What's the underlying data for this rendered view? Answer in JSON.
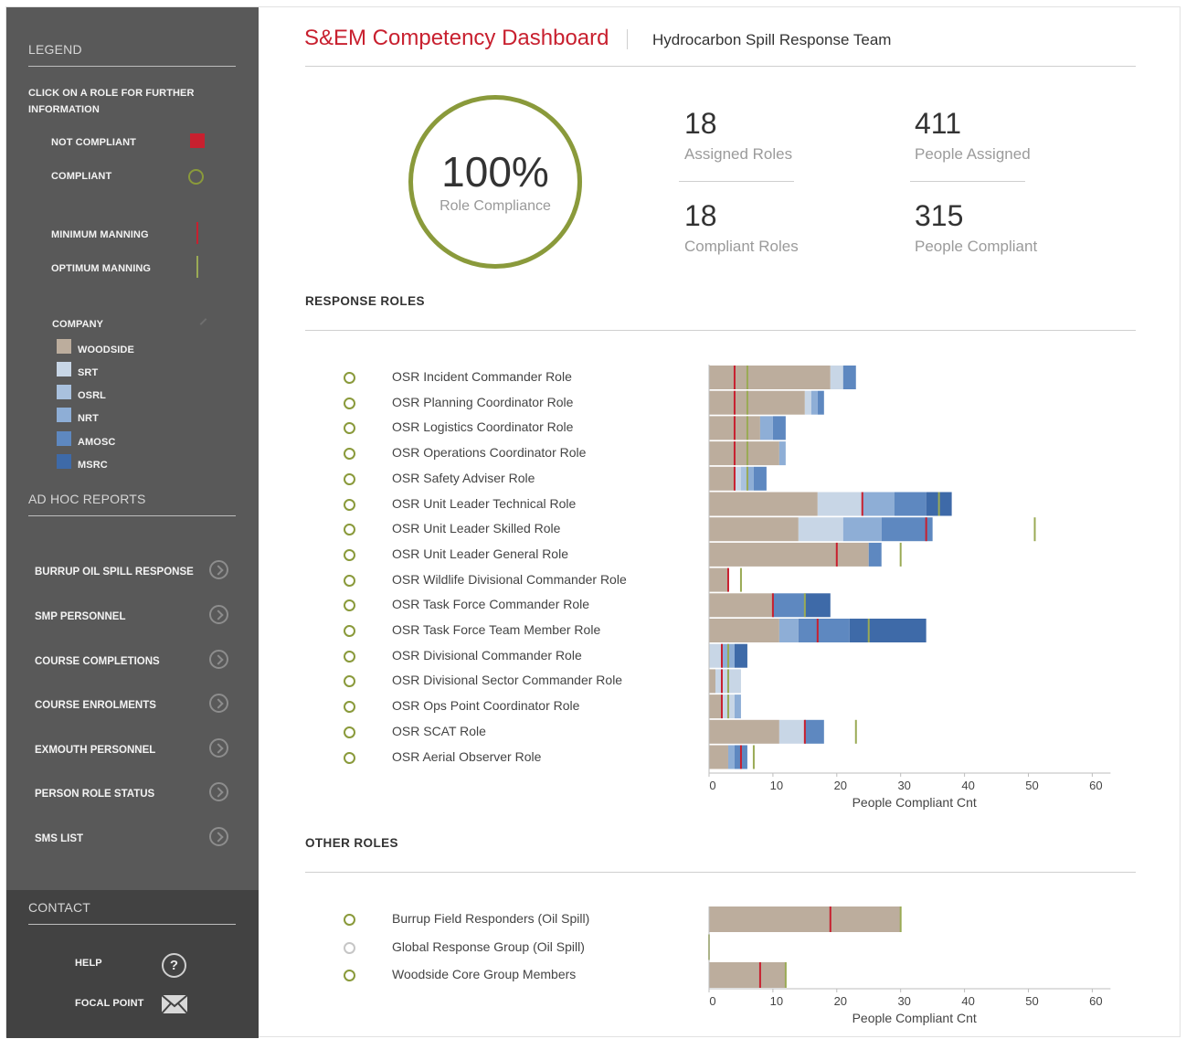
{
  "sidebar": {
    "legend_title": "LEGEND",
    "instructions": [
      "CLICK ON A ROLE FOR FURTHER",
      "INFORMATION"
    ],
    "status_items": [
      {
        "label": "NOT COMPLIANT",
        "icon": "red-square-icon",
        "color": "#c8202f"
      },
      {
        "label": "COMPLIANT",
        "icon": "green-ring-icon",
        "color": "#8a9a3b"
      }
    ],
    "manning_items": [
      {
        "label": "MINIMUM MANNING",
        "icon": "red-line-icon",
        "color": "#c8202f"
      },
      {
        "label": "OPTIMUM MANNING",
        "icon": "green-line-icon",
        "color": "#9aaa55"
      }
    ],
    "company_title": "COMPANY",
    "companies": [
      {
        "label": "WOODSIDE",
        "color": "#bcad9d"
      },
      {
        "label": "SRT",
        "color": "#c8d6e6"
      },
      {
        "label": "OSRL",
        "color": "#a9c1de"
      },
      {
        "label": "NRT",
        "color": "#8eaed6"
      },
      {
        "label": "AMOSC",
        "color": "#5e88c0"
      },
      {
        "label": "MSRC",
        "color": "#3e6aa8"
      }
    ],
    "adhoc_title": "AD HOC REPORTS",
    "reports": [
      "BURRUP OIL SPILL RESPONSE",
      "SMP PERSONNEL",
      "COURSE COMPLETIONS",
      "COURSE ENROLMENTS",
      "EXMOUTH PERSONNEL",
      "PERSON ROLE STATUS",
      "SMS LIST"
    ],
    "contact_title": "CONTACT",
    "contact_items": [
      {
        "label": "HELP",
        "icon": "help-circle-icon"
      },
      {
        "label": "FOCAL POINT",
        "icon": "envelope-icon"
      }
    ]
  },
  "header": {
    "title": "S&EM Competency Dashboard",
    "team": "Hydrocarbon Spill Response Team"
  },
  "summary": {
    "compliance_value": "100%",
    "compliance_label": "Role Compliance",
    "compliance_fraction": 1.0,
    "stats": [
      {
        "value": "18",
        "label": "Assigned Roles"
      },
      {
        "value": "411",
        "label": "People Assigned"
      },
      {
        "value": "18",
        "label": "Compliant Roles"
      },
      {
        "value": "315",
        "label": "People Compliant"
      }
    ]
  },
  "response_title": "RESPONSE ROLES",
  "other_title": "OTHER ROLES",
  "chart_data": [
    {
      "type": "bar",
      "orientation": "horizontal",
      "stacked": true,
      "xlabel": "People Compliant Cnt",
      "xlim": [
        0,
        60
      ],
      "xticks": [
        0,
        10,
        20,
        30,
        40,
        50,
        60
      ],
      "status_color_compliant": "#8a9a3b",
      "categories": [
        "OSR Incident Commander Role",
        "OSR Planning Coordinator Role",
        "OSR Logistics Coordinator Role",
        "OSR Operations Coordinator Role",
        "OSR Safety Adviser Role",
        "OSR Unit Leader Technical Role",
        "OSR Unit Leader Skilled Role",
        "OSR Unit Leader General Role",
        "OSR Wildlife Divisional Commander Role",
        "OSR Task Force Commander Role",
        "OSR Task Force Team Member Role",
        "OSR Divisional Commander Role",
        "OSR Divisional Sector Commander Role",
        "OSR Ops Point Coordinator Role",
        "OSR SCAT Role",
        "OSR Aerial Observer Role"
      ],
      "status": [
        "compliant",
        "compliant",
        "compliant",
        "compliant",
        "compliant",
        "compliant",
        "compliant",
        "compliant",
        "compliant",
        "compliant",
        "compliant",
        "compliant",
        "compliant",
        "compliant",
        "compliant",
        "compliant"
      ],
      "series": [
        {
          "name": "WOODSIDE",
          "color": "#bcad9d",
          "values": [
            19,
            15,
            8,
            11,
            4,
            17,
            14,
            25,
            3,
            10,
            11,
            0,
            1,
            2,
            11,
            3
          ]
        },
        {
          "name": "SRT",
          "color": "#c8d6e6",
          "values": [
            2,
            1,
            0,
            0,
            1,
            7,
            7,
            0,
            0,
            0,
            0,
            2,
            4,
            2,
            4,
            0
          ]
        },
        {
          "name": "OSRL",
          "color": "#a9c1de",
          "values": [
            0,
            0,
            0,
            0,
            1,
            0,
            0,
            0,
            0,
            0,
            0,
            0,
            0,
            0,
            0,
            0
          ]
        },
        {
          "name": "NRT",
          "color": "#8eaed6",
          "values": [
            0,
            1,
            2,
            1,
            1,
            5,
            6,
            0,
            0,
            0,
            3,
            2,
            0,
            1,
            0,
            1
          ]
        },
        {
          "name": "AMOSC",
          "color": "#5e88c0",
          "values": [
            2,
            1,
            2,
            0,
            2,
            5,
            8,
            2,
            0,
            5,
            8,
            0,
            0,
            0,
            3,
            2
          ]
        },
        {
          "name": "MSRC",
          "color": "#3e6aa8",
          "values": [
            0,
            0,
            0,
            0,
            0,
            4,
            0,
            0,
            0,
            4,
            12,
            2,
            0,
            0,
            0,
            0
          ]
        }
      ],
      "minimum_manning": [
        4,
        4,
        4,
        4,
        4,
        24,
        34,
        20,
        3,
        10,
        17,
        2,
        2,
        2,
        15,
        5
      ],
      "optimum_manning": [
        6,
        6,
        6,
        6,
        6,
        36,
        51,
        30,
        5,
        15,
        25,
        3,
        3,
        3,
        23,
        7
      ]
    },
    {
      "type": "bar",
      "orientation": "horizontal",
      "stacked": true,
      "xlabel": "People Compliant Cnt",
      "xlim": [
        0,
        60
      ],
      "xticks": [
        0,
        10,
        20,
        30,
        40,
        50,
        60
      ],
      "categories": [
        "Burrup Field Responders (Oil Spill)",
        "Global Response Group (Oil Spill)",
        "Woodside Core Group Members"
      ],
      "status": [
        "compliant",
        "not-applicable",
        "compliant"
      ],
      "status_colors": {
        "compliant": "#8a9a3b",
        "not-applicable": "#c6c6c6"
      },
      "series": [
        {
          "name": "WOODSIDE",
          "color": "#bcad9d",
          "values": [
            30,
            0,
            12
          ]
        }
      ],
      "minimum_manning": [
        19,
        null,
        8
      ],
      "optimum_manning": [
        30,
        0,
        12
      ]
    }
  ]
}
